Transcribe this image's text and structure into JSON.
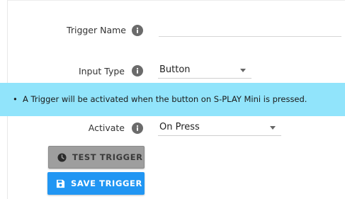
{
  "form": {
    "trigger_name": {
      "label": "Trigger Name",
      "value": ""
    },
    "input_type": {
      "label": "Input Type",
      "value": "Button"
    },
    "activate": {
      "label": "Activate",
      "value": "On Press"
    }
  },
  "banner": {
    "text": "A Trigger will be activated when the button on S-PLAY Mini is pressed.",
    "color": "#91e4fb"
  },
  "buttons": {
    "test_label": "TEST TRIGGER",
    "save_label": "SAVE TRIGGER",
    "test_icon": "clock-icon",
    "save_icon": "floppy-disk-icon"
  },
  "colors": {
    "primary": "#2196f3",
    "disabled": "#9e9e9e"
  }
}
